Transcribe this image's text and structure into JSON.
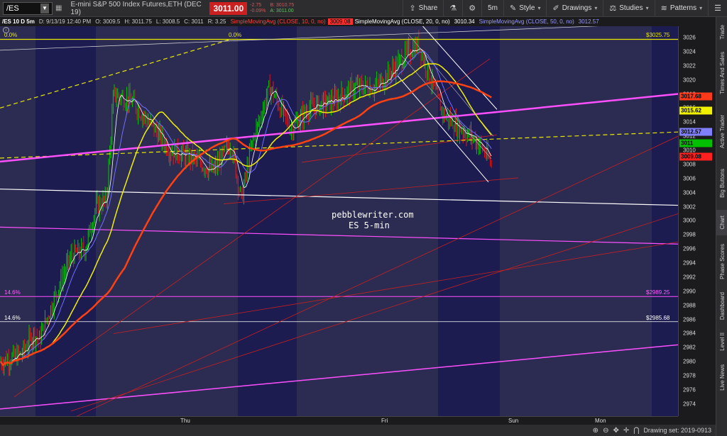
{
  "toolbar": {
    "symbol": "/ES",
    "instrument_desc": "E-mini S&P 500 Index Futures,ETH (DEC 19)",
    "last_price": "3011.00",
    "net_change": "-2.75",
    "pct_change": "-0.09%",
    "bid": "B: 3010.75",
    "ask": "A: 3011.00",
    "share_label": "Share",
    "timeframe_label": "5m",
    "style_label": "Style",
    "drawings_label": "Drawings",
    "studies_label": "Studies",
    "patterns_label": "Patterns"
  },
  "study_header": {
    "symbol_info": "/ES 10 D 5m",
    "date": "D: 9/13/19 12:40 PM",
    "open": "O: 3009.5",
    "high": "H: 3011.75",
    "low": "L: 3008.5",
    "close": "C: 3011",
    "range": "R: 3.25",
    "sma10": "SimpleMovingAvg (CLOSE, 10, 0, no)",
    "sma10_val": "3009.08",
    "sma20": "SimpleMovingAvg (CLOSE, 20, 0, no)",
    "sma20_val": "3010.34",
    "sma50": "SimpleMovingAvg (CLOSE, 50, 0, no)",
    "sma50_val": "3012.57"
  },
  "chart_labels": {
    "watermark_line1": "pebblewriter.com",
    "watermark_line2": "ES 5-min",
    "fib_top_left": "0.0%",
    "fib_top_mid": "0.0%",
    "fib_top_price": "$3025.75",
    "fib_mid_left": "14.6%",
    "fib_mid_price": "$2989.25",
    "fib_low_left": "14.6%",
    "fib_low_price": "$2985.68"
  },
  "price_axis": {
    "ticks": [
      "3026",
      "3024",
      "3022",
      "3020",
      "3018",
      "3016",
      "3014",
      "3012",
      "3010",
      "3008",
      "3006",
      "3004",
      "3002",
      "3000",
      "2998",
      "2996",
      "2994",
      "2992",
      "2990",
      "2988",
      "2986",
      "2984",
      "2982",
      "2980",
      "2978",
      "2976",
      "2974"
    ],
    "tags": [
      {
        "label": "3017.68",
        "price": 3017.68,
        "bg": "#ff3a1a",
        "fg": "#000000"
      },
      {
        "label": "3015.62",
        "price": 3015.62,
        "bg": "#f0f000",
        "fg": "#000000"
      },
      {
        "label": "3012.57",
        "price": 3012.57,
        "bg": "#8080ff",
        "fg": "#000000"
      },
      {
        "label": "3011",
        "price": 3011,
        "bg": "#00c000",
        "fg": "#000000"
      },
      {
        "label": "3009.08",
        "price": 3009.08,
        "bg": "#ff2020",
        "fg": "#000000"
      }
    ]
  },
  "time_axis": {
    "labels": [
      "Thu",
      "Fri",
      "Sun",
      "Mon"
    ]
  },
  "status_bar": {
    "drawing_set": "Drawing set: 2019-0913"
  },
  "sidebar": {
    "tabs": [
      "Trade",
      "Times And Sales",
      "Active Trader",
      "Big Buttons",
      "Chart",
      "Phase Scores",
      "Dashboard",
      "Level II",
      "Live News"
    ]
  },
  "colors": {
    "chart_bg": "#1a1a4a",
    "session_band": "#2b2b4e",
    "fib_yellow": "#e8e800",
    "magenta": "#ff50ff",
    "sma10": "#ffffff",
    "sma20": "#7070ff",
    "sma50": "#f0f000",
    "sma_red": "#ff4010"
  }
}
